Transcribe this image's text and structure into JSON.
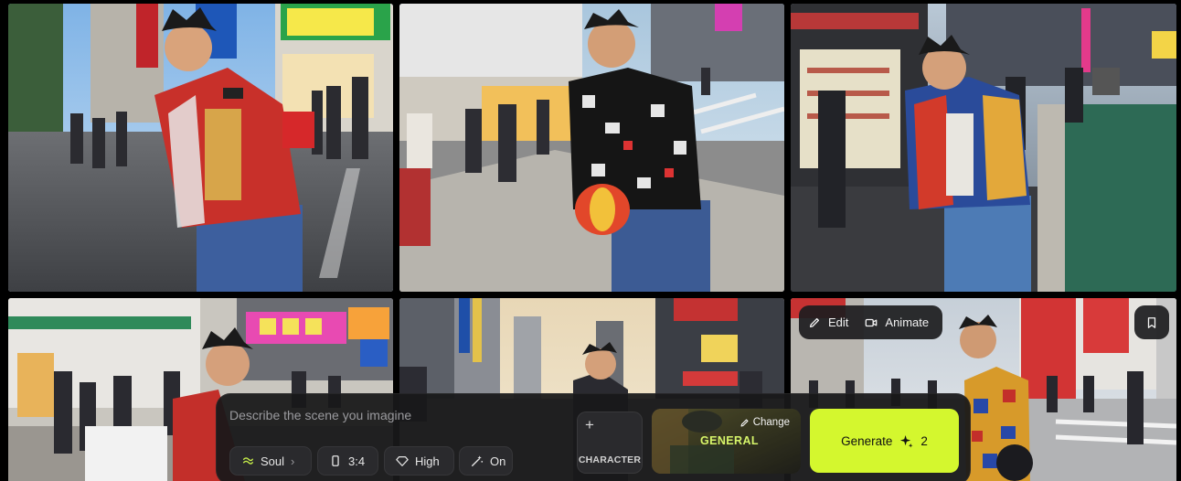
{
  "gallery": {
    "tiles": [
      {
        "name": "photo-1",
        "scene": "street-day"
      },
      {
        "name": "photo-2",
        "scene": "crosswalk"
      },
      {
        "name": "photo-3",
        "scene": "shop-evening"
      },
      {
        "name": "photo-4",
        "scene": "street-signs"
      },
      {
        "name": "photo-5",
        "scene": "avenue-sunset"
      },
      {
        "name": "photo-6",
        "scene": "crossing-crowd"
      }
    ],
    "toolbar": {
      "edit_label": "Edit",
      "animate_label": "Animate",
      "edit_icon": "pencil-icon",
      "animate_icon": "video-icon",
      "bookmark_icon": "bookmark-icon"
    }
  },
  "composer": {
    "prompt_placeholder": "Describe the scene you imagine",
    "prompt_value": "",
    "model_label": "Soul",
    "aspect_label": "3:4",
    "quality_label": "High",
    "enhance_label": "On",
    "character_label": "CHARACTER",
    "style_change_label": "Change",
    "style_name": "GENERAL",
    "generate_label": "Generate",
    "generate_cost": "2"
  },
  "colors": {
    "accent": "#d4f72e",
    "panel": "#18181a",
    "pill": "#2a2a2d",
    "style_text": "#d6f56a"
  }
}
